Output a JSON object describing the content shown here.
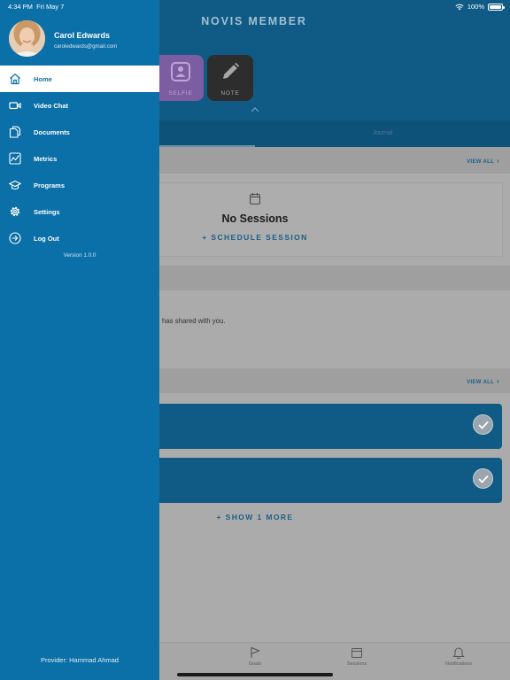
{
  "status_bar": {
    "time": "4:34 PM",
    "date": "Fri May 7",
    "battery": "100%"
  },
  "drawer": {
    "profile": {
      "name": "Carol Edwards",
      "email": "caroledwards@gmail.com"
    },
    "items": [
      {
        "label": "Home",
        "icon": "home-icon",
        "active": true
      },
      {
        "label": "Video Chat",
        "icon": "video-camera-icon",
        "active": false
      },
      {
        "label": "Documents",
        "icon": "documents-icon",
        "active": false
      },
      {
        "label": "Metrics",
        "icon": "metrics-chart-icon",
        "active": false
      },
      {
        "label": "Programs",
        "icon": "graduation-cap-icon",
        "active": false
      },
      {
        "label": "Settings",
        "icon": "gear-icon",
        "active": false
      },
      {
        "label": "Log Out",
        "icon": "logout-arrow-icon",
        "active": false
      }
    ],
    "version": "Version 1.0.0",
    "provider": "Provider: Hammad Ahmad"
  },
  "app": {
    "title": "NOVIS MEMBER",
    "quick_actions": {
      "selfie": "SELFIE",
      "note": "NOTE"
    },
    "tabs": {
      "journal": "Journal"
    },
    "view_all": "VIEW ALL",
    "sessions": {
      "empty_title": "No Sessions",
      "schedule": "+ SCHEDULE SESSION"
    },
    "shared_text": "has shared with you.",
    "goals": {
      "show_more": "+ SHOW 1 MORE"
    },
    "bottom_tabs": {
      "goals": "Goals",
      "sessions": "Sessions",
      "notifications": "Notifications"
    }
  },
  "colors": {
    "drawer": "#0b6fa8",
    "brand_dark": "#0f5b86",
    "active_item_bg": "#ffffff"
  }
}
